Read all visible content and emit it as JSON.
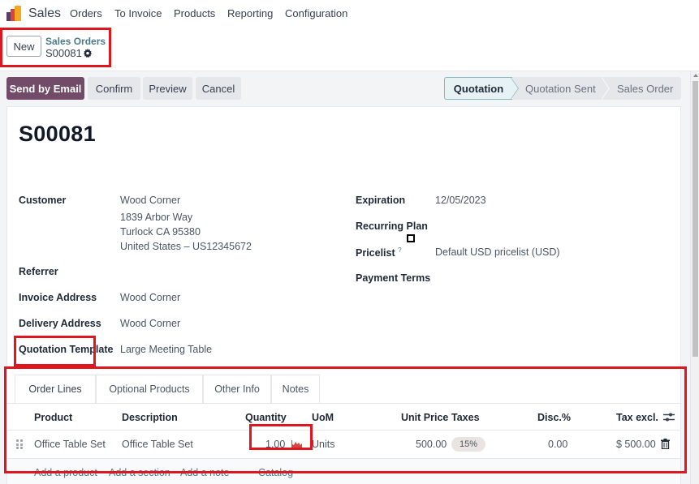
{
  "app": {
    "name": "Sales",
    "logo_icon": "sales-app-logo",
    "menu": [
      "Orders",
      "To Invoice",
      "Products",
      "Reporting",
      "Configuration"
    ]
  },
  "control_panel": {
    "new_label": "New",
    "breadcrumb_parent": "Sales Orders",
    "breadcrumb_current": "S00081",
    "settings_icon": "gear-icon"
  },
  "actions": {
    "send_email": "Send by Email",
    "confirm": "Confirm",
    "preview": "Preview",
    "cancel": "Cancel"
  },
  "status": {
    "stages": [
      "Quotation",
      "Quotation Sent",
      "Sales Order"
    ],
    "current": "Quotation"
  },
  "record": {
    "title": "S00081",
    "left_fields": {
      "customer_label": "Customer",
      "customer_name": "Wood Corner",
      "customer_address1": "1839 Arbor Way",
      "customer_address2": "Turlock CA 95380",
      "customer_address3": "United States – US12345672",
      "referrer_label": "Referrer",
      "invoice_address_label": "Invoice Address",
      "invoice_address": "Wood Corner",
      "delivery_address_label": "Delivery Address",
      "delivery_address": "Wood Corner",
      "quotation_template_label": "Quotation Template",
      "quotation_template": "Large Meeting Table"
    },
    "right_fields": {
      "expiration_label": "Expiration",
      "expiration": "12/05/2023",
      "recurring_plan_label": "Recurring Plan",
      "pricelist_label": "Pricelist",
      "pricelist_help": "?",
      "pricelist": "Default USD pricelist (USD)",
      "payment_terms_label": "Payment Terms"
    }
  },
  "tabs": [
    "Order Lines",
    "Optional Products",
    "Other Info",
    "Notes"
  ],
  "active_tab": "Order Lines",
  "order_lines": {
    "columns": [
      "Product",
      "Description",
      "Quantity",
      "UoM",
      "Unit Price",
      "Taxes",
      "Disc.%",
      "Tax excl."
    ],
    "rows": [
      {
        "product": "Office Table Set",
        "description": "Office Table Set",
        "quantity": "1.00",
        "uom": "Units",
        "unit_price": "500.00",
        "taxes": "15%",
        "discount": "0.00",
        "subtotal": "$ 500.00"
      }
    ],
    "add_links": {
      "add_product": "Add a product",
      "add_section": "Add a section",
      "add_note": "Add a note",
      "catalog": "Catalog"
    }
  },
  "colors": {
    "primary": "#714b67",
    "link": "#4b7a8c",
    "highlight": "#e0161f",
    "status_active_bg": "#e6f2f3"
  }
}
